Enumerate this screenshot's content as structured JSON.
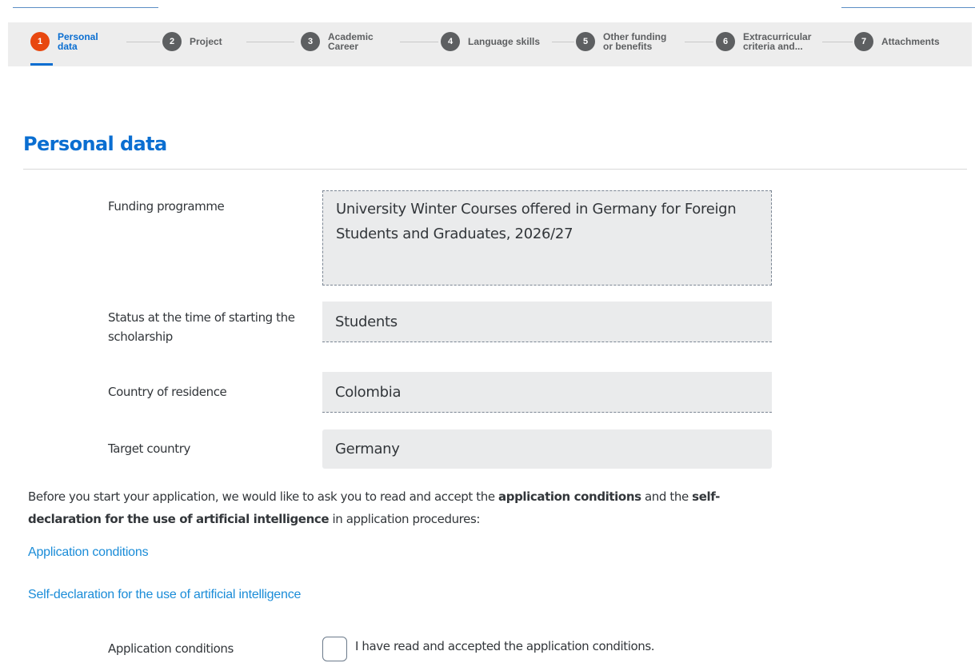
{
  "stepper": {
    "steps": [
      {
        "number": "1",
        "label": "Personal\ndata"
      },
      {
        "number": "2",
        "label": "Project"
      },
      {
        "number": "3",
        "label": "Academic\nCareer"
      },
      {
        "number": "4",
        "label": "Language skills"
      },
      {
        "number": "5",
        "label": "Other funding\nor benefits"
      },
      {
        "number": "6",
        "label": "Extracurricular\ncriteria and..."
      },
      {
        "number": "7",
        "label": "Attachments"
      }
    ],
    "active_step": 1
  },
  "section": {
    "title": "Personal data"
  },
  "form": {
    "funding_programme": {
      "label": "Funding programme",
      "value": "University Winter Courses offered in Germany for Foreign Students and Graduates, 2026/27"
    },
    "status": {
      "label": "Status at the time of starting the scholarship",
      "value": "Students"
    },
    "country_of_residence": {
      "label": "Country of residence",
      "value": "Colombia"
    },
    "target_country": {
      "label": "Target country",
      "value": "Germany"
    }
  },
  "intro": {
    "part1": "Before you start your application, we would like to ask you to read and accept the ",
    "bold1": "application conditions",
    "part2": " and the ",
    "bold2": "self-declaration for the use of artificial intelligence",
    "part3": " in application procedures:"
  },
  "links": {
    "application_conditions": "Application conditions",
    "self_declaration": "Self-declaration for the use of artificial intelligence"
  },
  "acceptance": {
    "label": "Application conditions",
    "checkbox_text": "I have read and accepted the application conditions.",
    "checked": false
  },
  "colors": {
    "accent_blue": "#0a6ed1",
    "active_step": "#e8470f",
    "link": "#1a8cd8"
  }
}
